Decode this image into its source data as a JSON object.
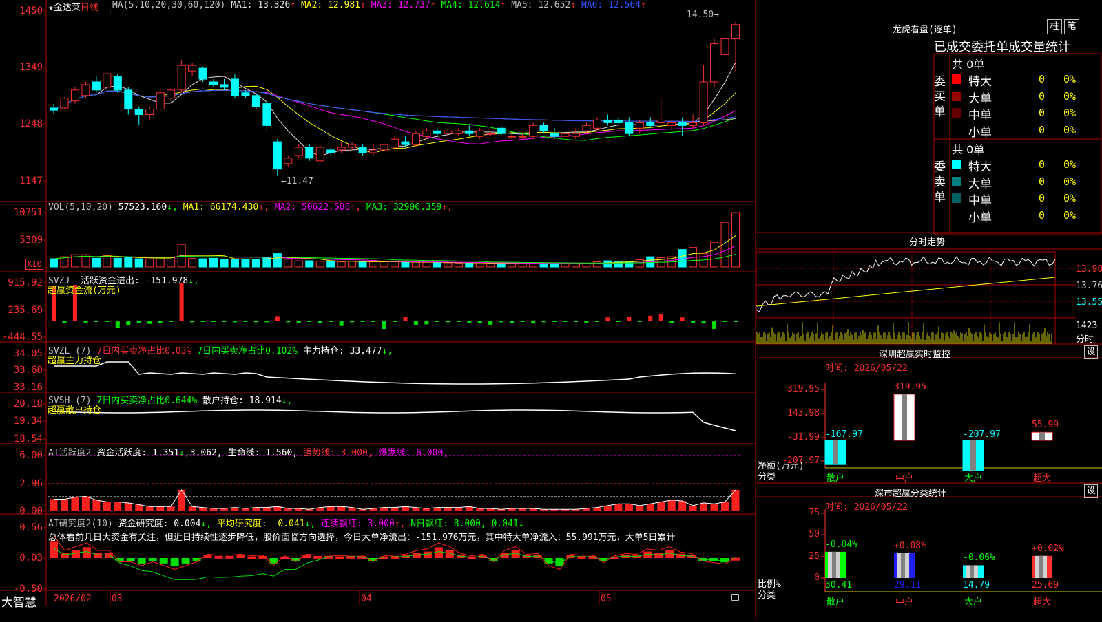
{
  "stock": {
    "star": "★",
    "name": "金达莱",
    "period": "日线",
    "cursor": "+"
  },
  "ma_header": {
    "label": "MA(5,10,20,30,60,120)",
    "items": [
      {
        "k": "MA1:",
        "v": "13.326",
        "arrow": "↑",
        "color": "#e0e0e0"
      },
      {
        "k": "MA2:",
        "v": "12.981",
        "arrow": "↑",
        "color": "#ffff00"
      },
      {
        "k": "MA3:",
        "v": "12.737",
        "arrow": "↑",
        "color": "#ff00ff"
      },
      {
        "k": "MA4:",
        "v": "12.614",
        "arrow": "↑",
        "color": "#00ff00"
      },
      {
        "k": "MA5:",
        "v": "12.652",
        "arrow": "↑",
        "color": "#c0c0c0"
      },
      {
        "k": "MA6:",
        "v": "12.564",
        "arrow": "↑",
        "color": "#3050ff"
      }
    ]
  },
  "price_axis": [
    "1450",
    "1349",
    "1248",
    "1147"
  ],
  "price_annotations": {
    "high": "14.50",
    "low": "11.47"
  },
  "vol_header": {
    "label": "VOL(5,10,20)",
    "v": "57523.160",
    "v_arrow": "↓",
    "items": [
      {
        "k": "MA1:",
        "v": "66174.430",
        "arrow": "↑",
        "color": "#ffff00"
      },
      {
        "k": "MA2:",
        "v": "50622.508",
        "arrow": "↑",
        "color": "#ff00ff"
      },
      {
        "k": "MA3:",
        "v": "32906.359",
        "arrow": "↑",
        "color": "#00ff00"
      }
    ]
  },
  "vol_axis": [
    "10751",
    "5309"
  ],
  "vol_unit": "X10",
  "svzj": {
    "label": "SVZJ",
    "text": "活跃资金进出:",
    "v": "-151.978",
    "arrow": "↓,",
    "subtitle": "超赢资金流(万元)",
    "axis": [
      "915.92",
      "235.69",
      "-444.55"
    ]
  },
  "svzl": {
    "label": "SVZL (7)",
    "t1": "7日内买卖净占比0.03%",
    "t2": "7日内买卖净占比0.102%",
    "t3": "主力持仓:",
    "v": "33.477",
    "arrow": "↓,",
    "subtitle": "超赢主力持仓",
    "axis": [
      "34.05",
      "33.60",
      "33.16"
    ]
  },
  "svsh": {
    "label": "SVSH (7)",
    "t1": "7日内买卖净占比0.644%",
    "t2": "散户持仓:",
    "v": "18.914",
    "arrow": "↓,",
    "subtitle": "超赢散户持仓",
    "axis": [
      "20.18",
      "19.34",
      "18.54"
    ]
  },
  "ai2": {
    "label": "AI活跃度2",
    "t1": "资金活跃度:",
    "v1": "1.351",
    "a1": "↓,",
    "v2": "3.062,",
    "t2": "生命线:",
    "v3": "1.560,",
    "t3": "强势线:",
    "v4": "3.000,",
    "t4": "爆发线:",
    "v5": "6.000,",
    "axis": [
      "6.00",
      "2.96",
      "0.00"
    ]
  },
  "ai_research": {
    "label": "AI研究度2(10)",
    "t1": "资金研究度:",
    "v1": "0.004",
    "a1": "↓,",
    "t2": "平均研究度:",
    "v2": "-0.041",
    "a2": "↓,",
    "t3": "连续飘红:",
    "v3": "3.000",
    "a3": "↑,",
    "t4": "N日飘红:",
    "v4": "8.000,",
    "v5": "-0.041",
    "a5": "↓",
    "commentary": "总体看前几日大资金有关注，但近日持续性逐步降低，股价面临方向选择，今日大单净流出：-151.976万元，其中特大单净流入：55.991万元，大单5日累计",
    "axis": [
      "0.56",
      "0.03",
      "-0.50"
    ]
  },
  "bottom": {
    "brand": "大智慧",
    "dates": [
      "2026/02",
      "03",
      "04",
      "05"
    ]
  },
  "longhu": {
    "title": "龙虎看盘(逐单)",
    "tab1": "柱",
    "tab2": "笔",
    "header": "已成交委托单成交量统计",
    "buy_label": "委买单",
    "sell_label": "委卖单",
    "buy_total": "共 0单",
    "sell_total": "共 0单",
    "buy_rows": [
      {
        "name": "特大",
        "color": "#ff0000",
        "n": "0",
        "p": "0%"
      },
      {
        "name": "大单",
        "color": "#990000",
        "n": "0",
        "p": "0%"
      },
      {
        "name": "中单",
        "color": "#660000",
        "n": "0",
        "p": "0%"
      },
      {
        "name": "小单",
        "color": "",
        "n": "0",
        "p": "0%"
      }
    ],
    "sell_rows": [
      {
        "name": "特大",
        "color": "#00ffff",
        "n": "0",
        "p": "0%"
      },
      {
        "name": "大单",
        "color": "#008080",
        "n": "0",
        "p": "0%"
      },
      {
        "name": "中单",
        "color": "#006060",
        "n": "0",
        "p": "0%"
      },
      {
        "name": "小单",
        "color": "",
        "n": "0",
        "p": "0%"
      }
    ]
  },
  "intraday": {
    "title": "分时走势",
    "axis": [
      "13.98",
      "13.76",
      "13.55"
    ],
    "vol_label": "1423",
    "vol_unit": "分时"
  },
  "realtime": {
    "title": "深圳超赢实时监控",
    "set": "设",
    "time": "时间: 2026/05/22",
    "axis": [
      "319.95",
      "143.98",
      "-31.99",
      "-207.97"
    ],
    "ylabel": "净额(万元)",
    "xlabel": "分类",
    "bars": [
      {
        "cat": "散户",
        "value": -167.97,
        "label": "-167.97"
      },
      {
        "cat": "中户",
        "value": 319.95,
        "label": "319.95"
      },
      {
        "cat": "大户",
        "value": -207.97,
        "label": "-207.97"
      },
      {
        "cat": "超大",
        "value": 55.99,
        "label": "55.99"
      }
    ]
  },
  "classify": {
    "title": "深市超赢分类统计",
    "set": "设",
    "time": "时间: 2026/05/22",
    "axis": [
      "75",
      "50",
      "25",
      "0"
    ],
    "ylabel": "比例%",
    "xlabel": "分类",
    "bars": [
      {
        "cat": "散户",
        "value": 30.41,
        "change": "-0.04%",
        "label": "30.41",
        "color": "#00ff00"
      },
      {
        "cat": "中户",
        "value": 29.11,
        "change": "+0.08%",
        "label": "29.11",
        "color": "#2020ff"
      },
      {
        "cat": "大户",
        "value": 14.79,
        "change": "-0.06%",
        "label": "14.79",
        "color": "#00ffff"
      },
      {
        "cat": "超大",
        "value": 25.69,
        "change": "+0.02%",
        "label": "25.69",
        "color": "#ff3030"
      }
    ]
  },
  "chart_data": {
    "type": "candlestick",
    "title": "金达莱 日线",
    "series_type": "ohlc",
    "x_labels": [
      "2026/02",
      "03",
      "04",
      "05"
    ],
    "ylim": [
      11.3,
      14.6
    ],
    "candles": [
      [
        12.72,
        12.8,
        12.62,
        12.68
      ],
      [
        12.72,
        12.92,
        12.7,
        12.9
      ],
      [
        12.85,
        13.1,
        12.8,
        13.05
      ],
      [
        12.95,
        13.2,
        12.9,
        13.15
      ],
      [
        13.2,
        13.3,
        13.0,
        13.05
      ],
      [
        13.1,
        13.4,
        13.05,
        13.35
      ],
      [
        13.3,
        13.35,
        13.0,
        13.05
      ],
      [
        13.05,
        13.1,
        12.6,
        12.7
      ],
      [
        12.7,
        12.75,
        12.4,
        12.6
      ],
      [
        12.6,
        12.75,
        12.5,
        12.7
      ],
      [
        12.7,
        13.1,
        12.65,
        13.0
      ],
      [
        12.9,
        13.1,
        12.85,
        13.05
      ],
      [
        13.05,
        13.6,
        13.0,
        13.5
      ],
      [
        13.4,
        13.55,
        13.3,
        13.5
      ],
      [
        13.45,
        13.48,
        13.2,
        13.25
      ],
      [
        13.2,
        13.25,
        13.1,
        13.15
      ],
      [
        13.15,
        13.25,
        13.05,
        13.1
      ],
      [
        13.25,
        13.35,
        12.9,
        12.95
      ],
      [
        13.0,
        13.05,
        12.9,
        12.95
      ],
      [
        12.95,
        13.0,
        12.7,
        12.75
      ],
      [
        12.8,
        12.85,
        12.3,
        12.4
      ],
      [
        12.1,
        12.15,
        11.47,
        11.6
      ],
      [
        11.7,
        11.85,
        11.65,
        11.8
      ],
      [
        11.85,
        12.05,
        11.8,
        12.0
      ],
      [
        12.0,
        12.05,
        11.75,
        11.8
      ],
      [
        11.75,
        12.05,
        11.7,
        12.0
      ],
      [
        11.95,
        12.0,
        11.85,
        11.9
      ],
      [
        11.95,
        12.1,
        11.9,
        12.0
      ],
      [
        12.0,
        12.1,
        11.95,
        12.05
      ],
      [
        12.0,
        12.05,
        11.85,
        11.9
      ],
      [
        11.9,
        12.05,
        11.85,
        11.95
      ],
      [
        11.95,
        12.1,
        11.9,
        12.05
      ],
      [
        12.0,
        12.2,
        11.95,
        12.15
      ],
      [
        12.1,
        12.2,
        12.0,
        12.05
      ],
      [
        12.05,
        12.3,
        12.0,
        12.25
      ],
      [
        12.2,
        12.35,
        12.15,
        12.3
      ],
      [
        12.3,
        12.35,
        12.2,
        12.25
      ],
      [
        12.25,
        12.35,
        12.2,
        12.3
      ],
      [
        12.25,
        12.35,
        12.2,
        12.3
      ],
      [
        12.3,
        12.4,
        12.2,
        12.25
      ],
      [
        12.2,
        12.35,
        12.15,
        12.3
      ],
      [
        12.25,
        12.3,
        12.2,
        12.25
      ],
      [
        12.35,
        12.4,
        12.2,
        12.25
      ],
      [
        12.2,
        12.25,
        12.15,
        12.2
      ],
      [
        12.2,
        12.25,
        12.15,
        12.2
      ],
      [
        12.2,
        12.45,
        12.15,
        12.4
      ],
      [
        12.4,
        12.45,
        12.25,
        12.3
      ],
      [
        12.25,
        12.35,
        12.15,
        12.2
      ],
      [
        12.2,
        12.35,
        12.15,
        12.25
      ],
      [
        12.2,
        12.35,
        12.15,
        12.25
      ],
      [
        12.3,
        12.45,
        12.25,
        12.4
      ],
      [
        12.35,
        12.55,
        12.3,
        12.5
      ],
      [
        12.5,
        12.6,
        12.4,
        12.45
      ],
      [
        12.5,
        12.55,
        12.4,
        12.45
      ],
      [
        12.45,
        12.55,
        12.2,
        12.25
      ],
      [
        12.35,
        12.5,
        12.25,
        12.45
      ],
      [
        12.45,
        12.55,
        12.35,
        12.4
      ],
      [
        12.45,
        12.9,
        12.4,
        12.5
      ],
      [
        12.4,
        12.5,
        12.3,
        12.45
      ],
      [
        12.45,
        12.55,
        12.2,
        12.4
      ],
      [
        12.4,
        12.6,
        12.35,
        12.45
      ],
      [
        12.45,
        13.5,
        12.4,
        13.2
      ],
      [
        13.2,
        14.0,
        13.1,
        13.9
      ],
      [
        13.7,
        14.5,
        13.6,
        14.0
      ],
      [
        14.0,
        14.3,
        13.4,
        14.25
      ]
    ],
    "vol_values": [
      1.6,
      2.0,
      2.4,
      2.4,
      1.7,
      2.2,
      1.7,
      1.9,
      1.6,
      1.6,
      1.8,
      1.8,
      4.4,
      1.7,
      1.6,
      1.7,
      1.5,
      1.5,
      1.5,
      1.5,
      1.8,
      2.6,
      1.5,
      1.2,
      1.2,
      1.1,
      1.1,
      1.0,
      1.1,
      1.0,
      1.0,
      1.0,
      1.0,
      0.9,
      0.9,
      0.9,
      0.9,
      0.8,
      0.7,
      0.8,
      0.8,
      0.7,
      0.7,
      0.7,
      0.6,
      0.7,
      0.7,
      0.6,
      0.6,
      0.6,
      0.7,
      1.0,
      1.2,
      1.0,
      1.0,
      1.4,
      2.0,
      1.8,
      2.0,
      3.4,
      3.8,
      2.6,
      4.8,
      8.7,
      10.6,
      6.0
    ],
    "svzj_values": [
      830,
      -60,
      870,
      -50,
      -30,
      -30,
      -170,
      -120,
      -60,
      -80,
      -50,
      -30,
      920,
      -40,
      -30,
      -30,
      -30,
      -40,
      -30,
      -40,
      -40,
      110,
      -40,
      -60,
      -30,
      -60,
      -30,
      -130,
      -40,
      -30,
      -30,
      -200,
      -30,
      100,
      -100,
      -90,
      -30,
      -40,
      -30,
      -60,
      -60,
      -110,
      -40,
      -60,
      -30,
      -70,
      -40,
      -30,
      -30,
      -30,
      -50,
      -30,
      80,
      -30,
      100,
      -30,
      120,
      150,
      -50,
      80,
      -60,
      -70,
      -200,
      -30,
      -30,
      80,
      -80
    ],
    "ai_values": [
      1.3,
      1.3,
      1.5,
      1.6,
      1.2,
      1.0,
      1.0,
      0.9,
      0.7,
      0.5,
      0.5,
      0.5,
      2.3,
      0.5,
      0.4,
      0.3,
      0.3,
      0.4,
      0.3,
      0.4,
      0.4,
      0.5,
      0.3,
      0.3,
      0.2,
      0.4,
      0.5,
      0.5,
      0.4,
      0.2,
      0.3,
      0.4,
      0.4,
      0.5,
      0.4,
      0.3,
      0.4,
      0.4,
      0.4,
      0.5,
      0.3,
      0.3,
      0.2,
      0.3,
      0.3,
      0.3,
      0.2,
      0.2,
      0.2,
      0.2,
      0.3,
      0.4,
      0.6,
      0.8,
      0.8,
      0.6,
      0.8,
      1.0,
      1.2,
      1.1,
      0.6,
      0.9,
      0.8,
      1.0,
      2.3,
      2.6,
      2.4,
      1.35
    ],
    "research_values": [
      0.3,
      0.1,
      0.15,
      0.2,
      0.1,
      0.1,
      -0.05,
      -0.05,
      -0.1,
      -0.05,
      -0.1,
      -0.15,
      -0.1,
      -0.05,
      0.05,
      0.04,
      0.04,
      0.05,
      0.03,
      0.04,
      -0.1,
      0.03,
      -0.05,
      0.05,
      0.04,
      0.04,
      0.03,
      0.04,
      0.04,
      -0.05,
      0.03,
      0.04,
      0.05,
      0.1,
      0.12,
      0.2,
      0.15,
      0.06,
      0.03,
      0.05,
      -0.05,
      0.1,
      0.15,
      0.05,
      0.06,
      -0.1,
      -0.15,
      0.05,
      0.04,
      0.04,
      -0.06,
      0.03,
      0.06,
      0.05,
      0.12,
      0.1,
      0.15,
      0.08,
      0.06,
      -0.04,
      -0.06,
      -0.08,
      0.004
    ]
  }
}
